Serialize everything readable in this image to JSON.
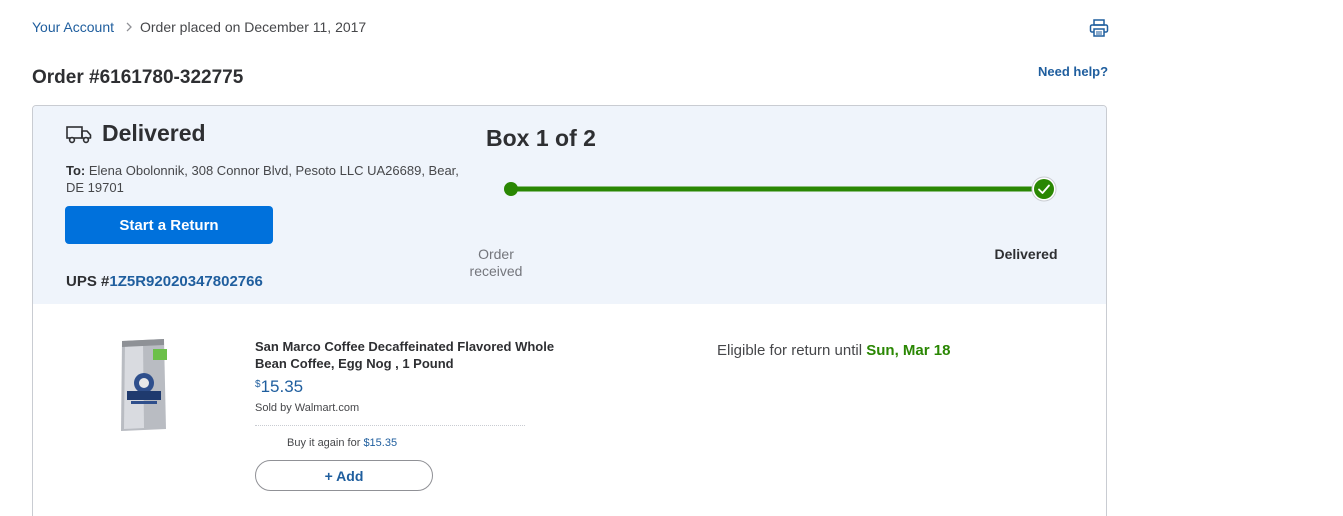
{
  "breadcrumb": {
    "account_link": "Your Account",
    "current": "Order placed on December 11, 2017"
  },
  "order": {
    "title": "Order #6161780-322775",
    "help_link": "Need help?"
  },
  "shipment": {
    "status": "Delivered",
    "to_label": "To:",
    "address": "Elena Obolonnik, 308 Connor Blvd, Pesoto LLC UA26689, Bear, DE 19701",
    "return_button": "Start a Return",
    "carrier_prefix": "UPS #",
    "tracking_number": "1Z5R92020347802766",
    "box_label": "Box 1 of 2",
    "progress": {
      "start_label": "Order received",
      "end_label": "Delivered",
      "completed_fraction": 1.0
    }
  },
  "item": {
    "name": "San Marco Coffee Decaffeinated Flavored Whole Bean Coffee, Egg Nog , 1 Pound",
    "price_currency": "$",
    "price_value": "15.35",
    "seller": "Sold by Walmart.com",
    "buy_again_prefix": "Buy it again for",
    "buy_again_price": "$15.35",
    "add_button": "+ Add",
    "return_eligibility_prefix": "Eligible for return until",
    "return_eligibility_date": "Sun, Mar 18"
  },
  "colors": {
    "link": "#1f5e9e",
    "primary_button": "#0071dc",
    "progress_green": "#2a8703",
    "card_header_bg": "#eff4fb"
  },
  "icons": [
    "chevron-right-icon",
    "print-icon",
    "truck-icon",
    "check-icon"
  ]
}
